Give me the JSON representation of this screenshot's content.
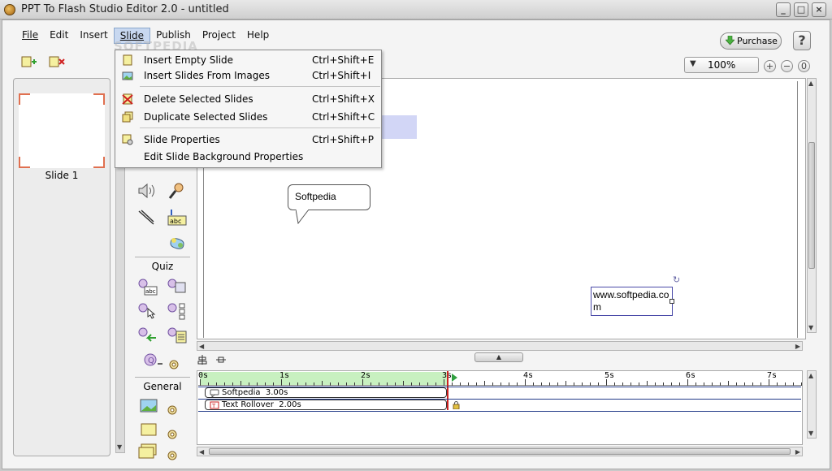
{
  "window": {
    "title": "PPT To Flash Studio Editor 2.0 - untitled"
  },
  "menubar": {
    "items": [
      {
        "label": "File",
        "active": false
      },
      {
        "label": "Edit",
        "active": false
      },
      {
        "label": "Insert",
        "active": false
      },
      {
        "label": "Slide",
        "active": true
      },
      {
        "label": "Publish",
        "active": false
      },
      {
        "label": "Project",
        "active": false
      },
      {
        "label": "Help",
        "active": false
      }
    ]
  },
  "toolbar": {
    "purchase_label": "Purchase",
    "help_label": "?",
    "zoom_value": "100%"
  },
  "watermark": "SOFTPEDIA",
  "slides_panel": {
    "slides": [
      {
        "label": "Slide 1"
      }
    ]
  },
  "palette": {
    "quiz_heading": "Quiz",
    "general_heading": "General"
  },
  "slide_menu": {
    "items": [
      {
        "label": "Insert Empty Slide",
        "shortcut": "Ctrl+Shift+E",
        "icon": "insert-slide-icon"
      },
      {
        "label": "Insert Slides From Images",
        "shortcut": "Ctrl+Shift+I",
        "icon": "image-slides-icon"
      },
      {
        "label": "Delete Selected Slides",
        "shortcut": "Ctrl+Shift+X",
        "icon": "delete-slides-icon"
      },
      {
        "label": "Duplicate Selected Slides",
        "shortcut": "Ctrl+Shift+C",
        "icon": "duplicate-slides-icon"
      },
      {
        "label": "Slide Properties",
        "shortcut": "Ctrl+Shift+P",
        "icon": "slide-properties-icon"
      },
      {
        "label": "Edit Slide Background Properties",
        "shortcut": "",
        "icon": ""
      }
    ]
  },
  "canvas": {
    "callout_text": "Softpedia",
    "url_text": "www.softpedia.com"
  },
  "timeline": {
    "ticks": [
      "0s",
      "1s",
      "2s",
      "3s",
      "4s",
      "5s",
      "6s",
      "7s"
    ],
    "playhead": "3s",
    "tracks": [
      {
        "name": "Softpedia",
        "duration": "3.00s"
      },
      {
        "name": "Text Rollover",
        "duration": "2.00s"
      }
    ]
  },
  "colors": {
    "menu_highlight": "#c8d8f0",
    "timeline_green": "#c8f0c0",
    "playhead": "#cc2020",
    "track_line": "#223a88"
  }
}
